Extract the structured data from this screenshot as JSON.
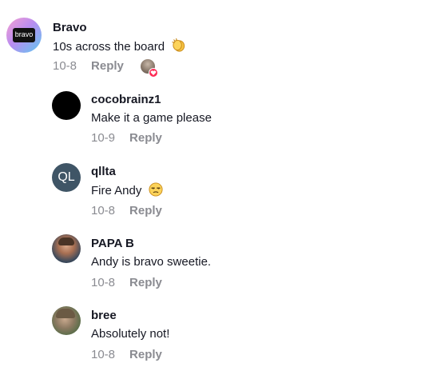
{
  "comments": [
    {
      "username": "Bravo",
      "avatar_text": "bravo",
      "text": "10s across the board",
      "emoji": "clapping-hands-emoji",
      "date": "10-8",
      "reply_label": "Reply",
      "liked_by_creator": true
    },
    {
      "username": "cocobrainz1",
      "text": "Make it a game please",
      "date": "10-9",
      "reply_label": "Reply"
    },
    {
      "username": "qllta",
      "avatar_initials": "QL",
      "text": "Fire Andy",
      "emoji": "unamused-face-emoji",
      "date": "10-8",
      "reply_label": "Reply"
    },
    {
      "username": "PAPA B",
      "text": "Andy is bravo sweetie.",
      "date": "10-8",
      "reply_label": "Reply"
    },
    {
      "username": "bree",
      "text": "Absolutely not!",
      "date": "10-8",
      "reply_label": "Reply"
    }
  ],
  "colors": {
    "text_primary": "#161823",
    "text_secondary": "#8a8b91",
    "heart": "#fe2c55",
    "initials_avatar_bg": "#3f5566"
  }
}
